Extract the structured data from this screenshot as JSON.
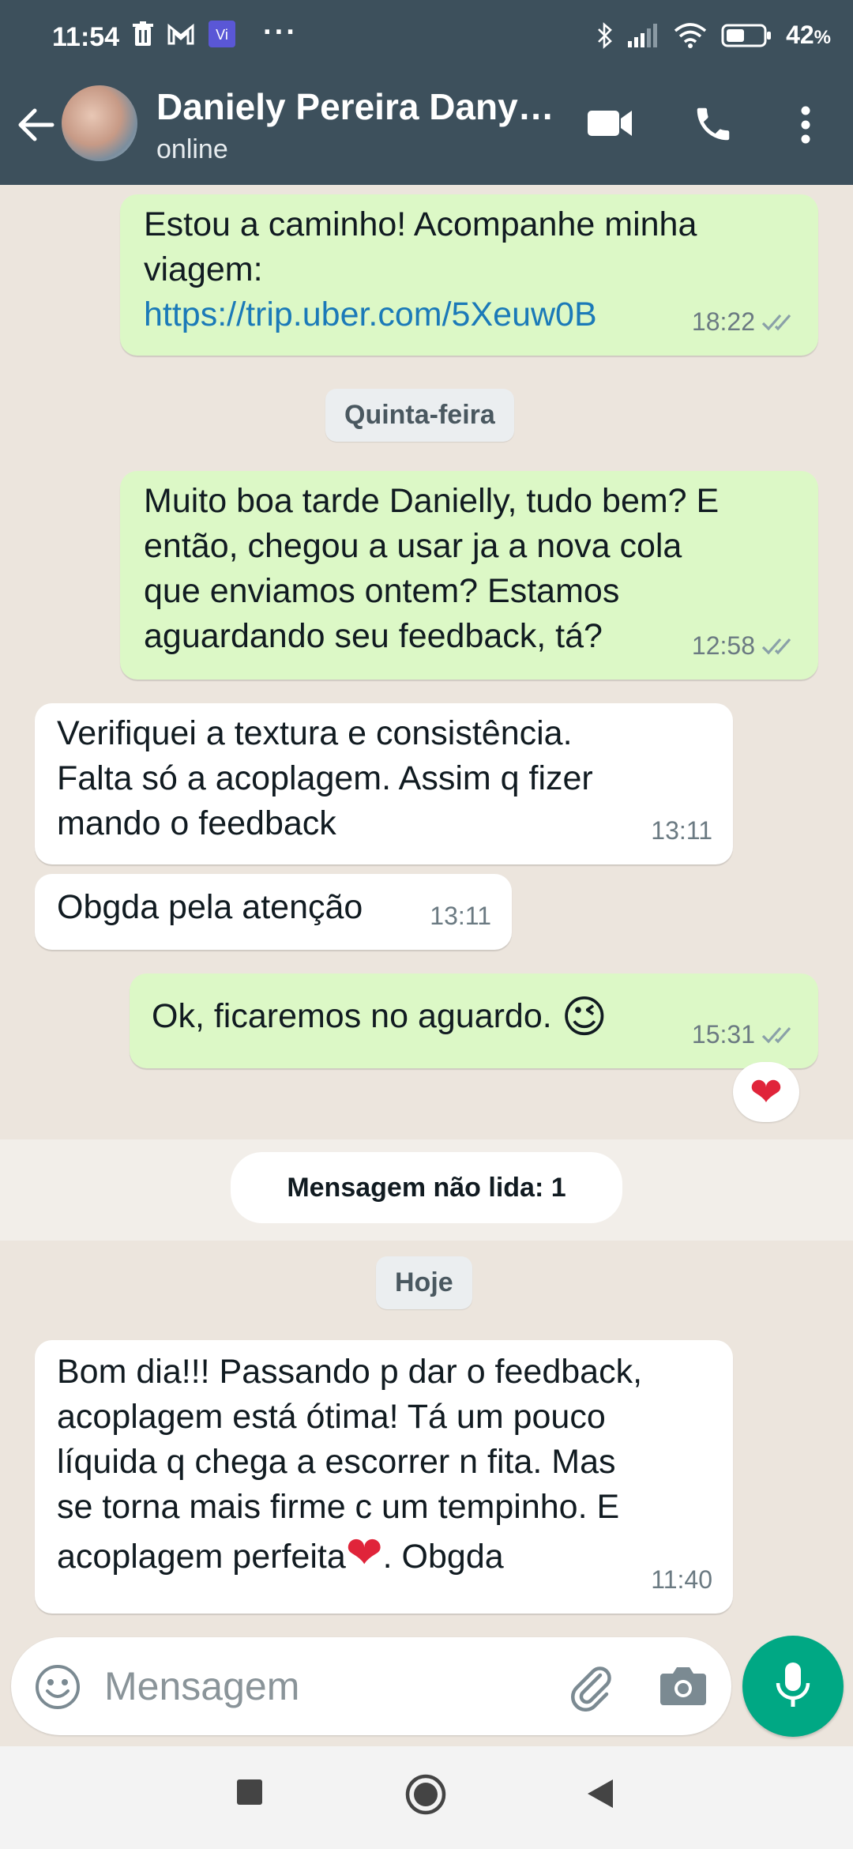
{
  "status_bar": {
    "time": "11:54",
    "battery": "42",
    "battery_unit": "%",
    "icons": [
      "trash-icon",
      "gmail-icon",
      "app-icon",
      "more-dots",
      "bluetooth-icon",
      "signal-icon",
      "wifi-icon",
      "battery-icon"
    ]
  },
  "header": {
    "contact_name": "Daniely Pereira Dany…",
    "status": "online"
  },
  "messages": [
    {
      "dir": "out",
      "text": "Estou a caminho! Acompanhe minha\nviagem:",
      "link": "https://trip.uber.com/5Xeuw0B",
      "time": "18:22",
      "ticks": "read"
    },
    {
      "dir": "date",
      "text": "Quinta-feira"
    },
    {
      "dir": "out",
      "text": "Muito boa tarde Danielly, tudo bem? E\nentão, chegou a usar ja a nova cola\nque enviamos ontem? Estamos\naguardando seu feedback, tá?",
      "time": "12:58",
      "ticks": "read"
    },
    {
      "dir": "in",
      "text": "Verifiquei a textura e consistência.\nFalta só a acoplagem. Assim q fizer\nmando o feedback",
      "time": "13:11"
    },
    {
      "dir": "in",
      "text": "Obgda pela atenção",
      "time": "13:11"
    },
    {
      "dir": "out",
      "text": "Ok, ficaremos no aguardo.",
      "emoji": "😉",
      "time": "15:31",
      "ticks": "read",
      "reaction": "❤"
    },
    {
      "dir": "unread",
      "text": "Mensagem não lida: 1"
    },
    {
      "dir": "date",
      "text": "Hoje"
    },
    {
      "dir": "in",
      "text_before": "Bom dia!!! Passando p dar o feedback,\nacoplagem está ótima! Tá um pouco\nlíquida q chega a escorrer n fita. Mas\nse torna mais firme c um tempinho. E\nacoplagem perfeita",
      "emoji": "❤",
      "text_after": ". Obgda",
      "time": "11:40"
    }
  ],
  "composer": {
    "placeholder": "Mensagem"
  },
  "colors": {
    "header_bg": "#3d505c",
    "outgoing_bubble": "#dcf8c6",
    "incoming_bubble": "#ffffff",
    "chat_bg": "#ece5dd",
    "mic_button": "#00a884",
    "link": "#1b7ab8",
    "read_ticks": "#8aa0a8"
  }
}
